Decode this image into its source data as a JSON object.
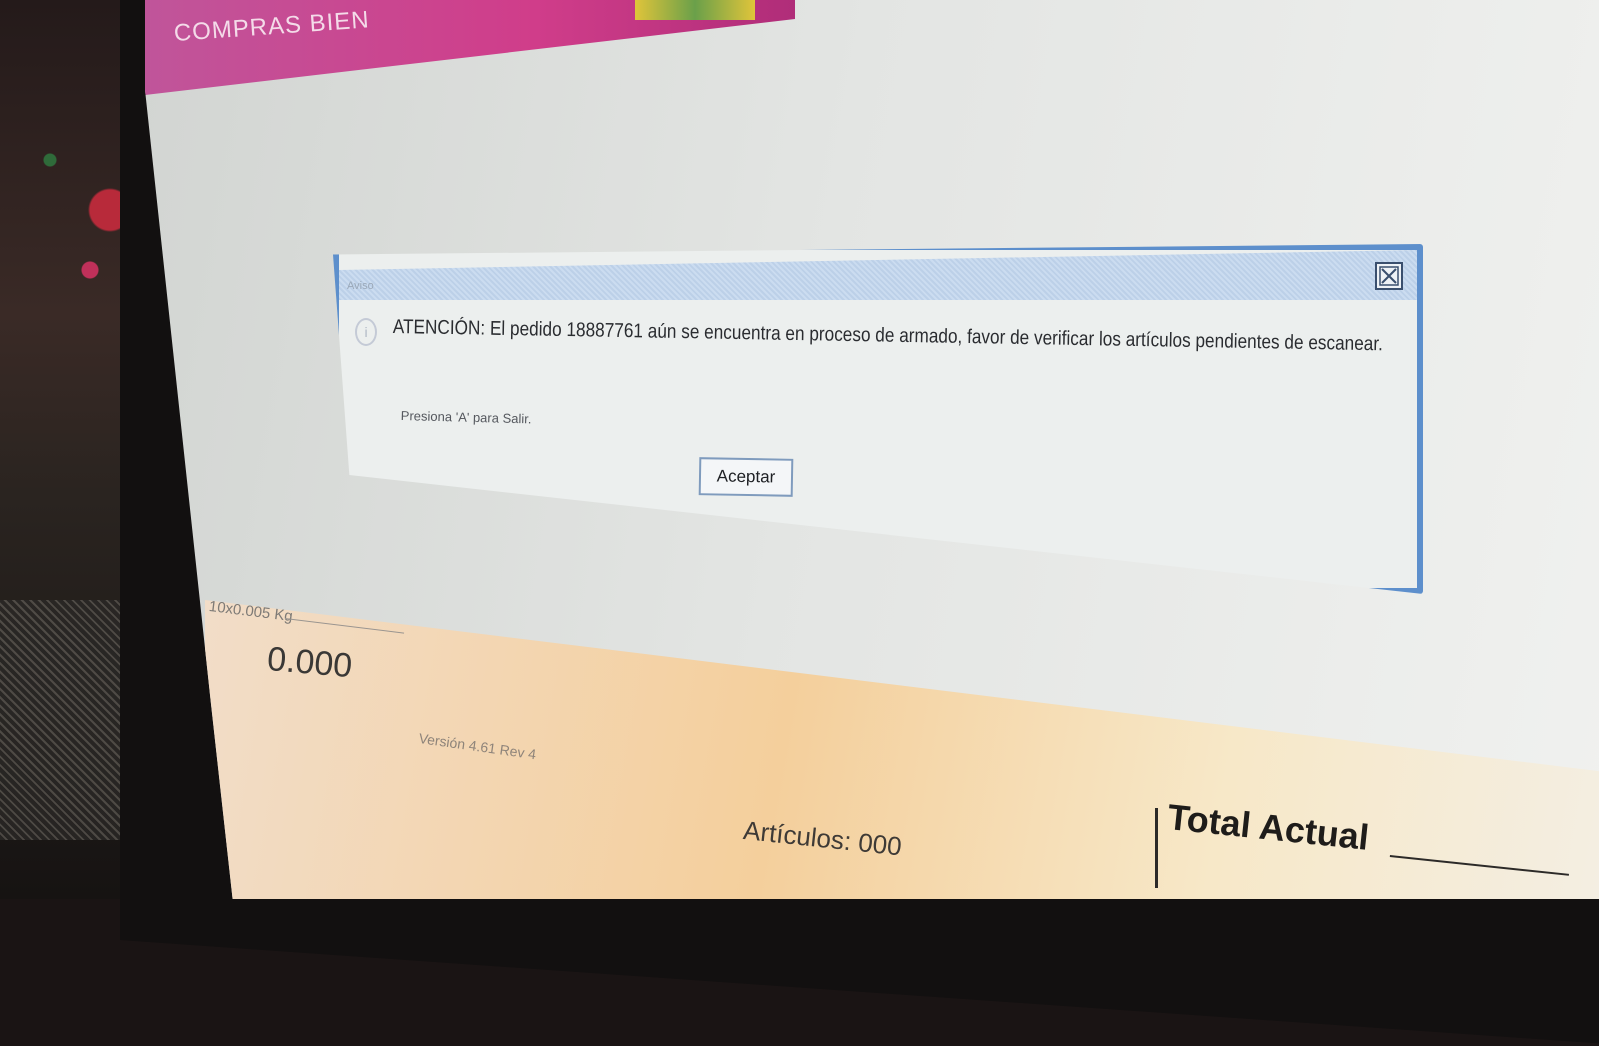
{
  "header": {
    "store_name": "COMPRAS BIEN"
  },
  "dialog": {
    "title": "Aviso",
    "message": "ATENCIÓN: El pedido 18887761 aún se encuentra en proceso de armado, favor de verificar los artículos pendientes de escanear.",
    "hint": "Presiona 'A' para Salir.",
    "accept_label": "Aceptar",
    "icon": "info-icon",
    "close_icon": "close-icon"
  },
  "scale": {
    "label": "10x0.005 Kg",
    "value": "0.000"
  },
  "footer": {
    "version": "Versión 4.61 Rev 4",
    "articles": "Artículos: 000",
    "total_label": "Total Actual"
  },
  "colors": {
    "header_magenta": "#d03d8a",
    "dialog_border": "#5d8fcc"
  }
}
